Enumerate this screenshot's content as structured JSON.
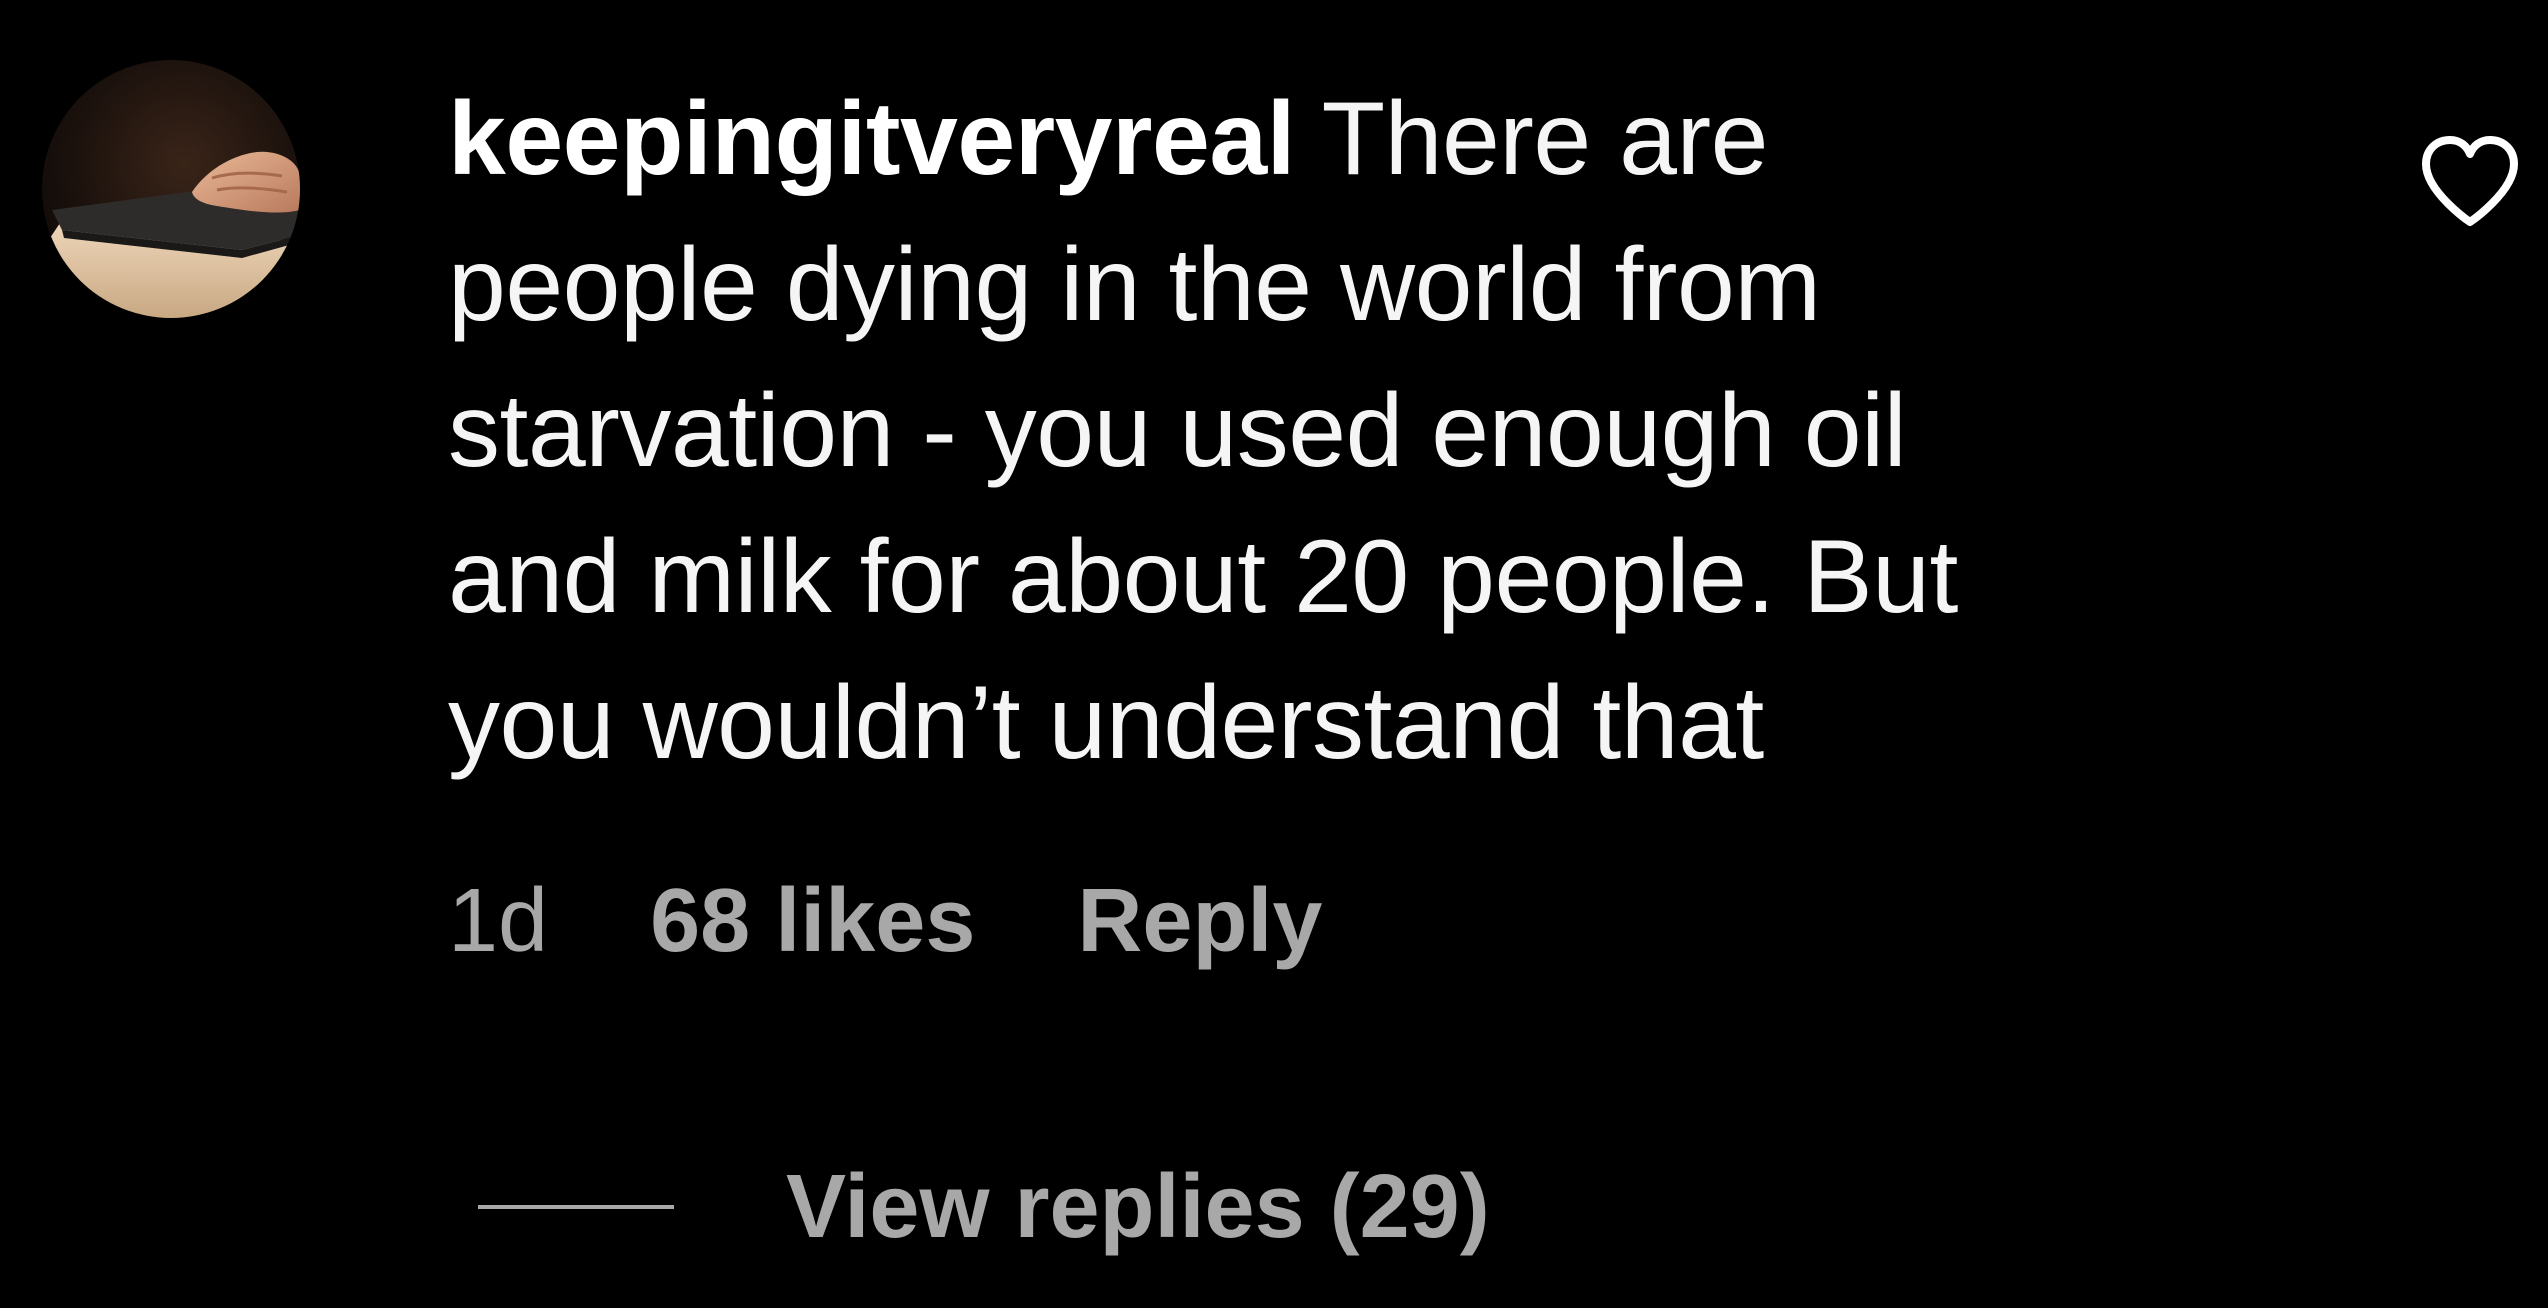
{
  "comment": {
    "username": "keepingitveryreal",
    "text": "There are\npeople dying in the world from\nstarvation - you used enough oil\nand milk for about 20 people. But\nyou wouldn’t understand that",
    "time": "1d",
    "likes": "68 likes",
    "reply_label": "Reply",
    "view_replies_label": "View replies (29)",
    "avatar_icon": "avatar-hand-on-book",
    "like_icon": "heart-outline-icon"
  },
  "colors": {
    "background": "#000000",
    "text_primary": "#ffffff",
    "text_secondary": "#a8a8a8"
  }
}
